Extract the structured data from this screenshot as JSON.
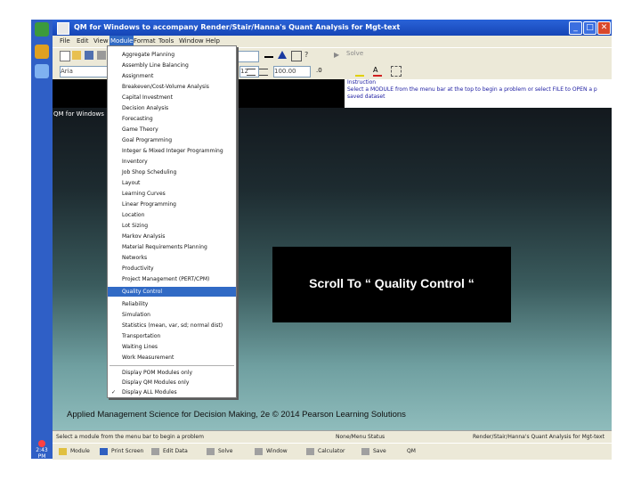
{
  "window": {
    "title": "QM for Windows to accompany Render/Stair/Hanna's Quant Analysis for Mgt-text",
    "minimize": "_",
    "maximize": "□",
    "close": "✕"
  },
  "menubar": {
    "items": [
      "File",
      "Edit",
      "View",
      "Module",
      "Format",
      "Tools",
      "Window",
      "Help"
    ]
  },
  "toolbar": {
    "font_combo": "Aria",
    "size_combo": "12",
    "zoom_combo": "100.00",
    "solve_label": "Solve"
  },
  "info_panel": {
    "line1": "Instruction",
    "line2": "Select a MODULE from the menu bar at the top to begin a problem or select FILE to OPEN a p",
    "line3": "saved dataset"
  },
  "desktop": {
    "qm_label": "QM for Windows"
  },
  "module_menu": {
    "items": [
      "Aggregate Planning",
      "Assembly Line Balancing",
      "Assignment",
      "Breakeven/Cost-Volume Analysis",
      "Capital Investment",
      "Decision Analysis",
      "Forecasting",
      "Game Theory",
      "Goal Programming",
      "Integer & Mixed Integer Programming",
      "Inventory",
      "Job Shop Scheduling",
      "Layout",
      "Learning Curves",
      "Linear Programming",
      "Location",
      "Lot Sizing",
      "Markov Analysis",
      "Material Requirements Planning",
      "Networks",
      "Productivity",
      "Project Management (PERT/CPM)",
      "Quality Control",
      "Reliability",
      "Simulation",
      "Statistics (mean, var, sd; normal dist)",
      "Transportation",
      "Waiting Lines",
      "Work Measurement"
    ],
    "selected": "Quality Control",
    "display_items": [
      "Display POM Modules only",
      "Display QM Modules only",
      "Display ALL Modules"
    ],
    "checked": "Display ALL Modules"
  },
  "callout": {
    "text": "Scroll To “ Quality Control “"
  },
  "footer": {
    "text": "Applied Management Science for Decision Making, 2e © 2014 Pearson Learning Solutions"
  },
  "statusbar": {
    "left": "Select a module from the menu bar to begin a problem",
    "mid": "None/Menu Status",
    "right": "Render/Stair/Hanna's Quant Analysis for Mgt-text"
  },
  "bottombar": {
    "items": [
      "Module",
      "Print Screen",
      "Edit Data",
      "Solve",
      "Window",
      "Calculator",
      "Save",
      "QM"
    ]
  },
  "clock": {
    "time": "2:43 PM"
  },
  "colors": {
    "titlebar": "#1545b6",
    "selection": "#316ac5",
    "callout_bg": "#000000"
  }
}
